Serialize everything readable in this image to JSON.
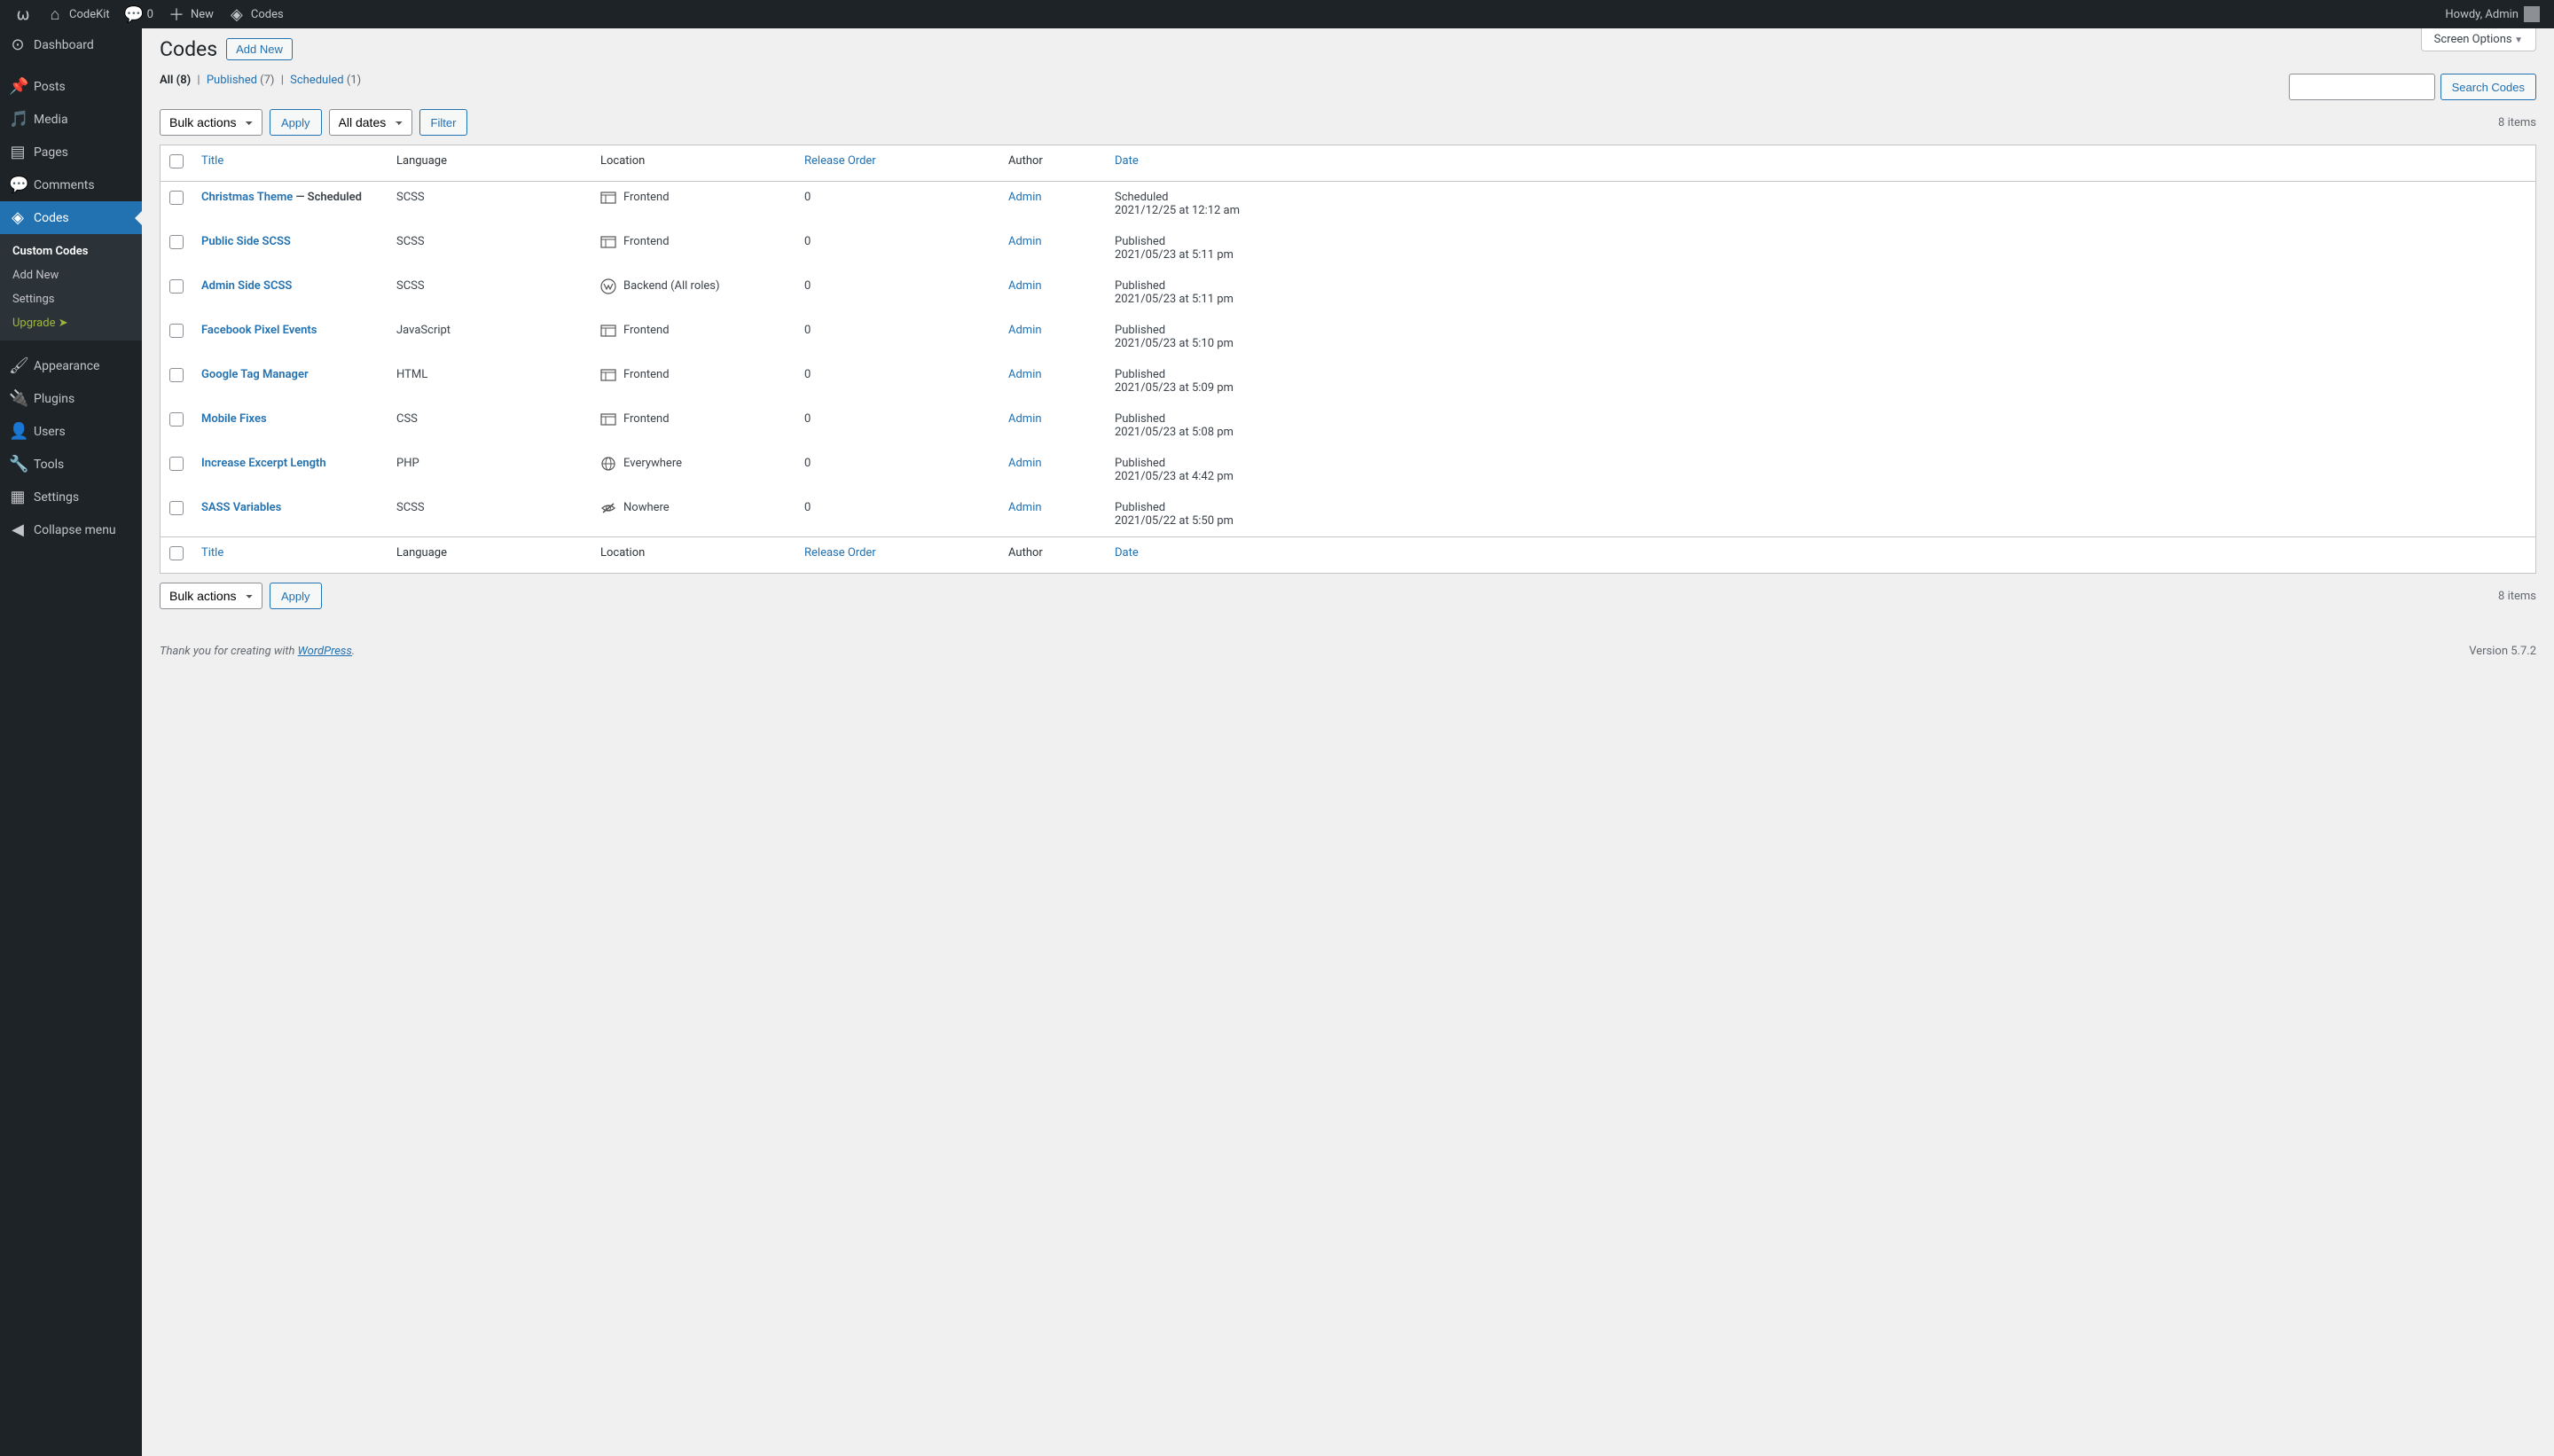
{
  "adminbar": {
    "site_name": "CodeKit",
    "comments_count": "0",
    "new_label": "New",
    "codes_label": "Codes",
    "howdy": "Howdy, Admin"
  },
  "sidebar": {
    "items": [
      {
        "label": "Dashboard"
      },
      {
        "label": "Posts"
      },
      {
        "label": "Media"
      },
      {
        "label": "Pages"
      },
      {
        "label": "Comments"
      },
      {
        "label": "Codes"
      },
      {
        "label": "Appearance"
      },
      {
        "label": "Plugins"
      },
      {
        "label": "Users"
      },
      {
        "label": "Tools"
      },
      {
        "label": "Settings"
      },
      {
        "label": "Collapse menu"
      }
    ],
    "submenu": {
      "custom_codes": "Custom Codes",
      "add_new": "Add New",
      "settings": "Settings",
      "upgrade": "Upgrade  ➤"
    }
  },
  "page": {
    "title": "Codes",
    "add_new": "Add New",
    "screen_options": "Screen Options"
  },
  "filters": {
    "all_label": "All",
    "all_count": "(8)",
    "published_label": "Published",
    "published_count": "(7)",
    "scheduled_label": "Scheduled",
    "scheduled_count": "(1)"
  },
  "controls": {
    "bulk_actions": "Bulk actions",
    "apply": "Apply",
    "all_dates": "All dates",
    "filter": "Filter",
    "search_codes": "Search Codes",
    "items_count": "8 items"
  },
  "columns": {
    "title": "Title",
    "language": "Language",
    "location": "Location",
    "release_order": "Release Order",
    "author": "Author",
    "date": "Date"
  },
  "rows": [
    {
      "title": "Christmas Theme",
      "title_extra": " — Scheduled",
      "language": "SCSS",
      "location": "Frontend",
      "loc_icon": "frontend",
      "release": "0",
      "author": "Admin",
      "date_status": "Scheduled",
      "date_time": "2021/12/25 at 12:12 am"
    },
    {
      "title": "Public Side SCSS",
      "title_extra": "",
      "language": "SCSS",
      "location": "Frontend",
      "loc_icon": "frontend",
      "release": "0",
      "author": "Admin",
      "date_status": "Published",
      "date_time": "2021/05/23 at 5:11 pm"
    },
    {
      "title": "Admin Side SCSS",
      "title_extra": "",
      "language": "SCSS",
      "location": "Backend (All roles)",
      "loc_icon": "backend",
      "release": "0",
      "author": "Admin",
      "date_status": "Published",
      "date_time": "2021/05/23 at 5:11 pm"
    },
    {
      "title": "Facebook Pixel Events",
      "title_extra": "",
      "language": "JavaScript",
      "location": "Frontend",
      "loc_icon": "frontend",
      "release": "0",
      "author": "Admin",
      "date_status": "Published",
      "date_time": "2021/05/23 at 5:10 pm"
    },
    {
      "title": "Google Tag Manager",
      "title_extra": "",
      "language": "HTML",
      "location": "Frontend",
      "loc_icon": "frontend",
      "release": "0",
      "author": "Admin",
      "date_status": "Published",
      "date_time": "2021/05/23 at 5:09 pm"
    },
    {
      "title": "Mobile Fixes",
      "title_extra": "",
      "language": "CSS",
      "location": "Frontend",
      "loc_icon": "frontend",
      "release": "0",
      "author": "Admin",
      "date_status": "Published",
      "date_time": "2021/05/23 at 5:08 pm"
    },
    {
      "title": "Increase Excerpt Length",
      "title_extra": "",
      "language": "PHP",
      "location": "Everywhere",
      "loc_icon": "everywhere",
      "release": "0",
      "author": "Admin",
      "date_status": "Published",
      "date_time": "2021/05/23 at 4:42 pm"
    },
    {
      "title": "SASS Variables",
      "title_extra": "",
      "language": "SCSS",
      "location": "Nowhere",
      "loc_icon": "nowhere",
      "release": "0",
      "author": "Admin",
      "date_status": "Published",
      "date_time": "2021/05/22 at 5:50 pm"
    }
  ],
  "footer": {
    "thanks_prefix": "Thank you for creating with ",
    "wordpress": "WordPress",
    "thanks_suffix": ".",
    "version": "Version 5.7.2"
  }
}
